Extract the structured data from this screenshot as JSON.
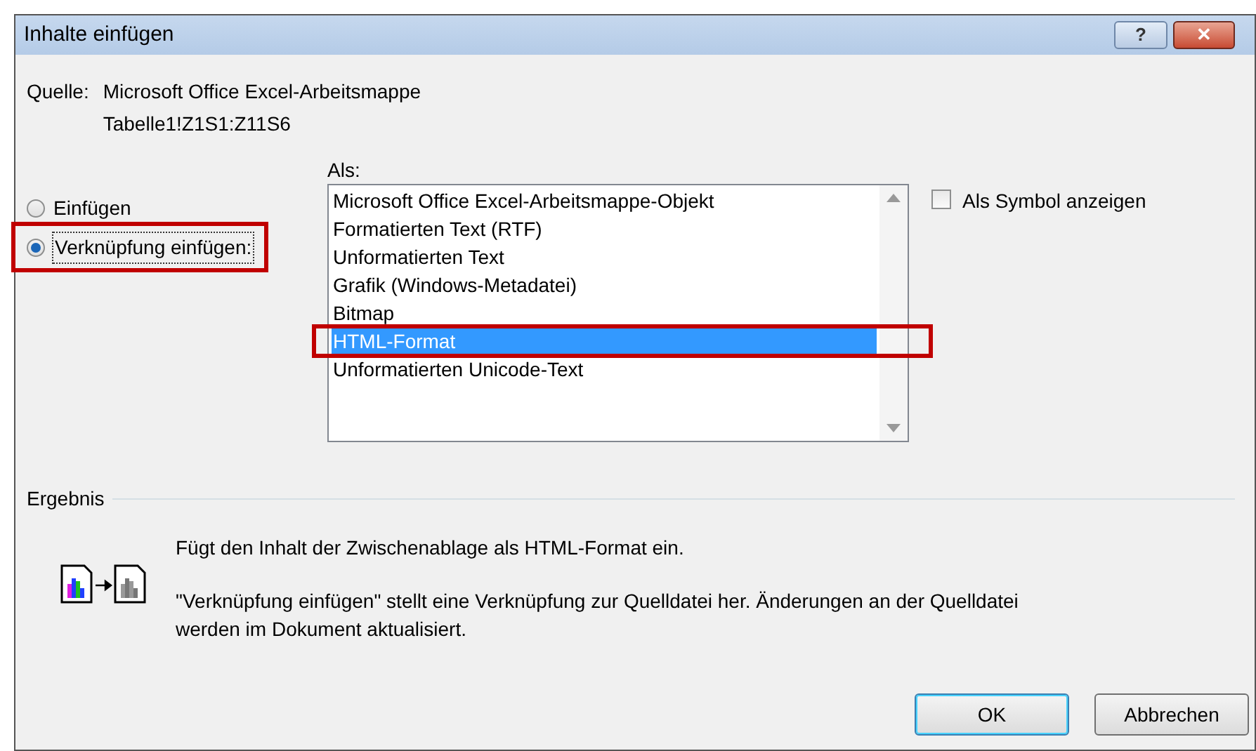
{
  "window": {
    "title": "Inhalte einfügen",
    "buttons": [
      {
        "kind": "help",
        "label": "?"
      },
      {
        "kind": "close",
        "label": "✕"
      }
    ]
  },
  "source": {
    "label": "Quelle:",
    "lines": [
      "Microsoft Office Excel-Arbeitsmappe",
      "Tabelle1!Z1S1:Z11S6"
    ]
  },
  "paste_options": [
    {
      "label": "Einfügen",
      "selected": false,
      "highlighted": false
    },
    {
      "label": "Verknüpfung einfügen:",
      "selected": true,
      "highlighted": true
    }
  ],
  "as_list": {
    "label": "Als:",
    "items": [
      {
        "label": "Microsoft Office Excel-Arbeitsmappe-Objekt",
        "selected": false,
        "highlighted": false
      },
      {
        "label": "Formatierten Text (RTF)",
        "selected": false,
        "highlighted": false
      },
      {
        "label": "Unformatierten Text",
        "selected": false,
        "highlighted": false
      },
      {
        "label": "Grafik (Windows-Metadatei)",
        "selected": false,
        "highlighted": false
      },
      {
        "label": "Bitmap",
        "selected": false,
        "highlighted": false
      },
      {
        "label": "HTML-Format",
        "selected": true,
        "highlighted": true
      },
      {
        "label": "Unformatierten Unicode-Text",
        "selected": false,
        "highlighted": false
      }
    ]
  },
  "show_as_icon": {
    "label": "Als Symbol anzeigen",
    "checked": false
  },
  "result": {
    "label": "Ergebnis",
    "lines": [
      "Fügt den Inhalt der Zwischenablage als HTML-Format ein.",
      "\"Verknüpfung einfügen\" stellt eine Verknüpfung zur Quelldatei her. Änderungen an der Quelldatei werden im Dokument aktualisiert."
    ]
  },
  "buttons": [
    {
      "label": "OK",
      "default": true
    },
    {
      "label": "Abbrechen",
      "default": false
    }
  ]
}
